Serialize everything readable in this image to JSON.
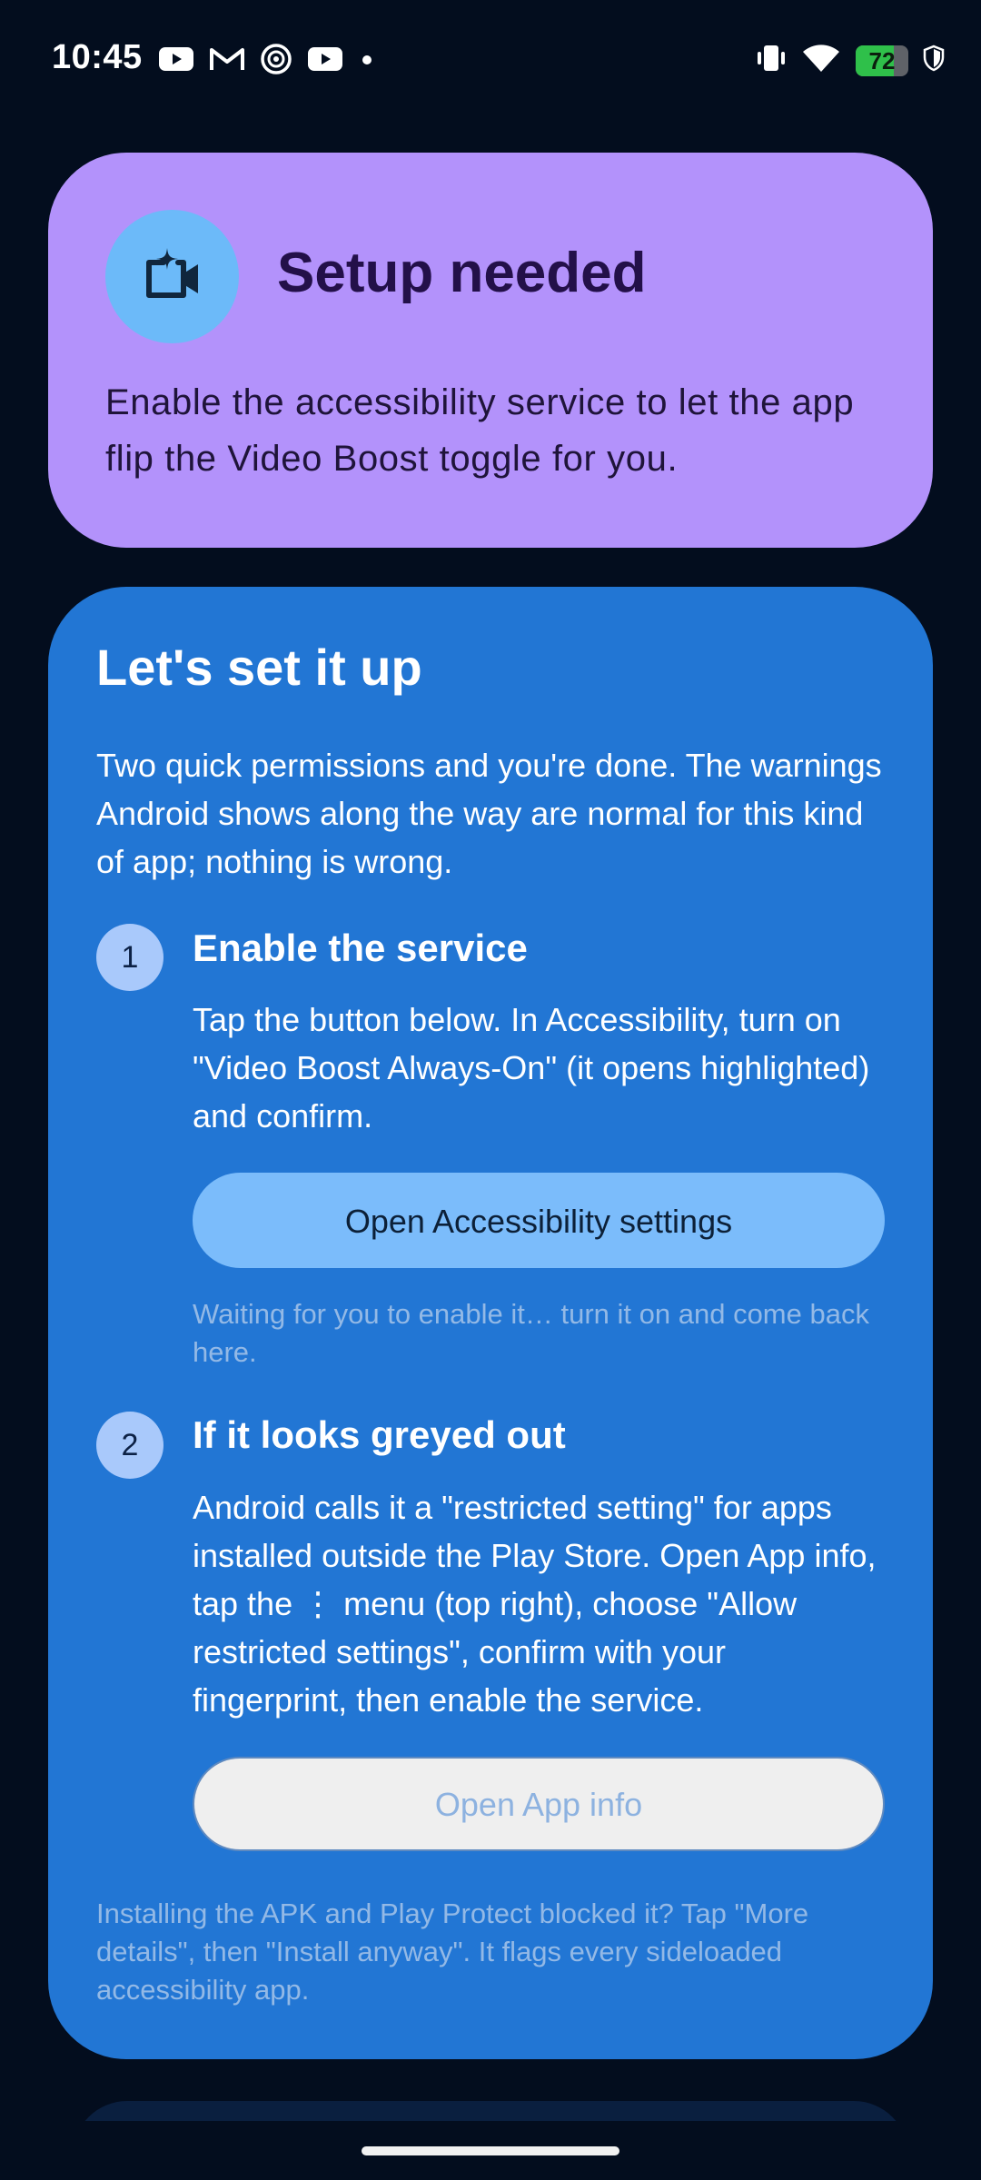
{
  "status_bar": {
    "time": "10:45",
    "notification_icons": [
      "youtube-icon",
      "gmail-icon",
      "threads-icon",
      "youtube-icon",
      "more-dot-icon"
    ],
    "system_icons": [
      "vibrate-icon",
      "wifi-icon",
      "battery-icon",
      "shield-icon"
    ],
    "battery_level": "72"
  },
  "setup_card": {
    "icon": "video-sparkle-icon",
    "title": "Setup needed",
    "body": "Enable the accessibility service to let the app flip the Video Boost toggle for you.",
    "color": "#b392fb"
  },
  "main_card": {
    "title": "Let's set it up",
    "intro": "Two quick permissions and you're done. The warnings Android shows along the way are normal for this kind of app; nothing is wrong.",
    "color": "#2276d4",
    "steps": [
      {
        "number": "1",
        "title": "Enable the service",
        "body": "Tap the button below. In Accessibility, turn on \"Video Boost Always-On\" (it opens highlighted) and confirm.",
        "button_label": "Open Accessibility settings",
        "hint": "Waiting for you to enable it… turn it on and come back here."
      },
      {
        "number": "2",
        "title": "If it looks greyed out",
        "body": "Android calls it a \"restricted setting\" for apps installed outside the Play Store. Open App info, tap the ⋮ menu (top right), choose \"Allow restricted settings\", confirm with your fingerprint, then enable the service.",
        "button_label": "Open App info"
      }
    ],
    "footer_note": "Installing the APK and Play Protect blocked it? Tap \"More details\", then \"Install anyway\". It flags every sideloaded accessibility app."
  }
}
